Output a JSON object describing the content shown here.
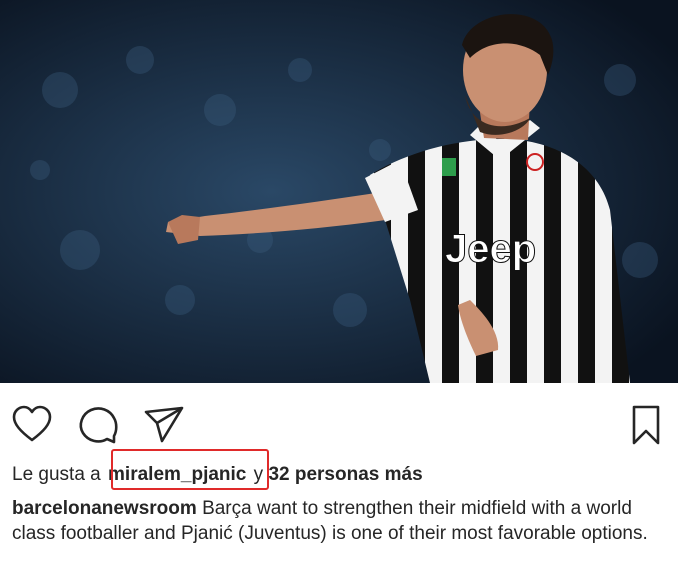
{
  "post": {
    "image": {
      "subject": "Footballer in Juventus jersey pointing",
      "jersey_text": "Jeep"
    },
    "actions": {
      "like_icon": "heart-icon",
      "comment_icon": "comment-icon",
      "share_icon": "send-icon",
      "save_icon": "bookmark-icon"
    },
    "likes": {
      "prefix": "Le gusta a",
      "user": "miralem_pjanic",
      "connector": "y",
      "count_text": "32 personas más"
    },
    "caption": {
      "author": "barcelonanewsroom",
      "text": "Barça want to strengthen their midfield with a world class footballer and Pjanić (Juventus) is one of their most favorable options."
    }
  },
  "colors": {
    "highlight": "#e02a2a",
    "text": "#262626",
    "background": "#ffffff"
  }
}
